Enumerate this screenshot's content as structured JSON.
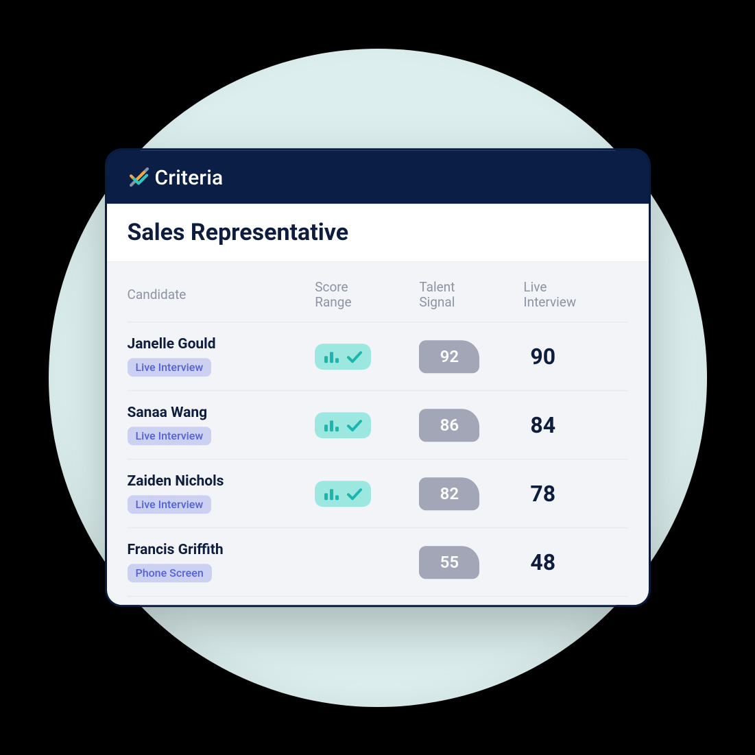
{
  "brand": {
    "name": "Criteria"
  },
  "title": "Sales Representative",
  "columns": {
    "candidate": "Candidate",
    "score_range": "Score\nRange",
    "talent_signal": "Talent\nSignal",
    "live_interview": "Live\nInterview"
  },
  "candidates": [
    {
      "name": "Janelle Gould",
      "stage": "Live Interview",
      "score_range_pass": true,
      "talent_signal": 92,
      "live_interview": 90
    },
    {
      "name": "Sanaa Wang",
      "stage": "Live Interview",
      "score_range_pass": true,
      "talent_signal": 86,
      "live_interview": 84
    },
    {
      "name": "Zaiden Nichols",
      "stage": "Live Interview",
      "score_range_pass": true,
      "talent_signal": 82,
      "live_interview": 78
    },
    {
      "name": "Francis Griffith",
      "stage": "Phone Screen",
      "score_range_pass": false,
      "talent_signal": 55,
      "live_interview": 48
    }
  ],
  "colors": {
    "header_bg": "#0b1e45",
    "body_bg": "#f2f4f8",
    "accent_teal": "#9de7e1",
    "accent_teal_dark": "#1bb6ad",
    "pill_bg": "#ccd1f2",
    "pill_text": "#5561d6",
    "badge_gray": "#a2a6b6",
    "text_dark": "#0e1d3e",
    "text_muted": "#8c93a3"
  }
}
